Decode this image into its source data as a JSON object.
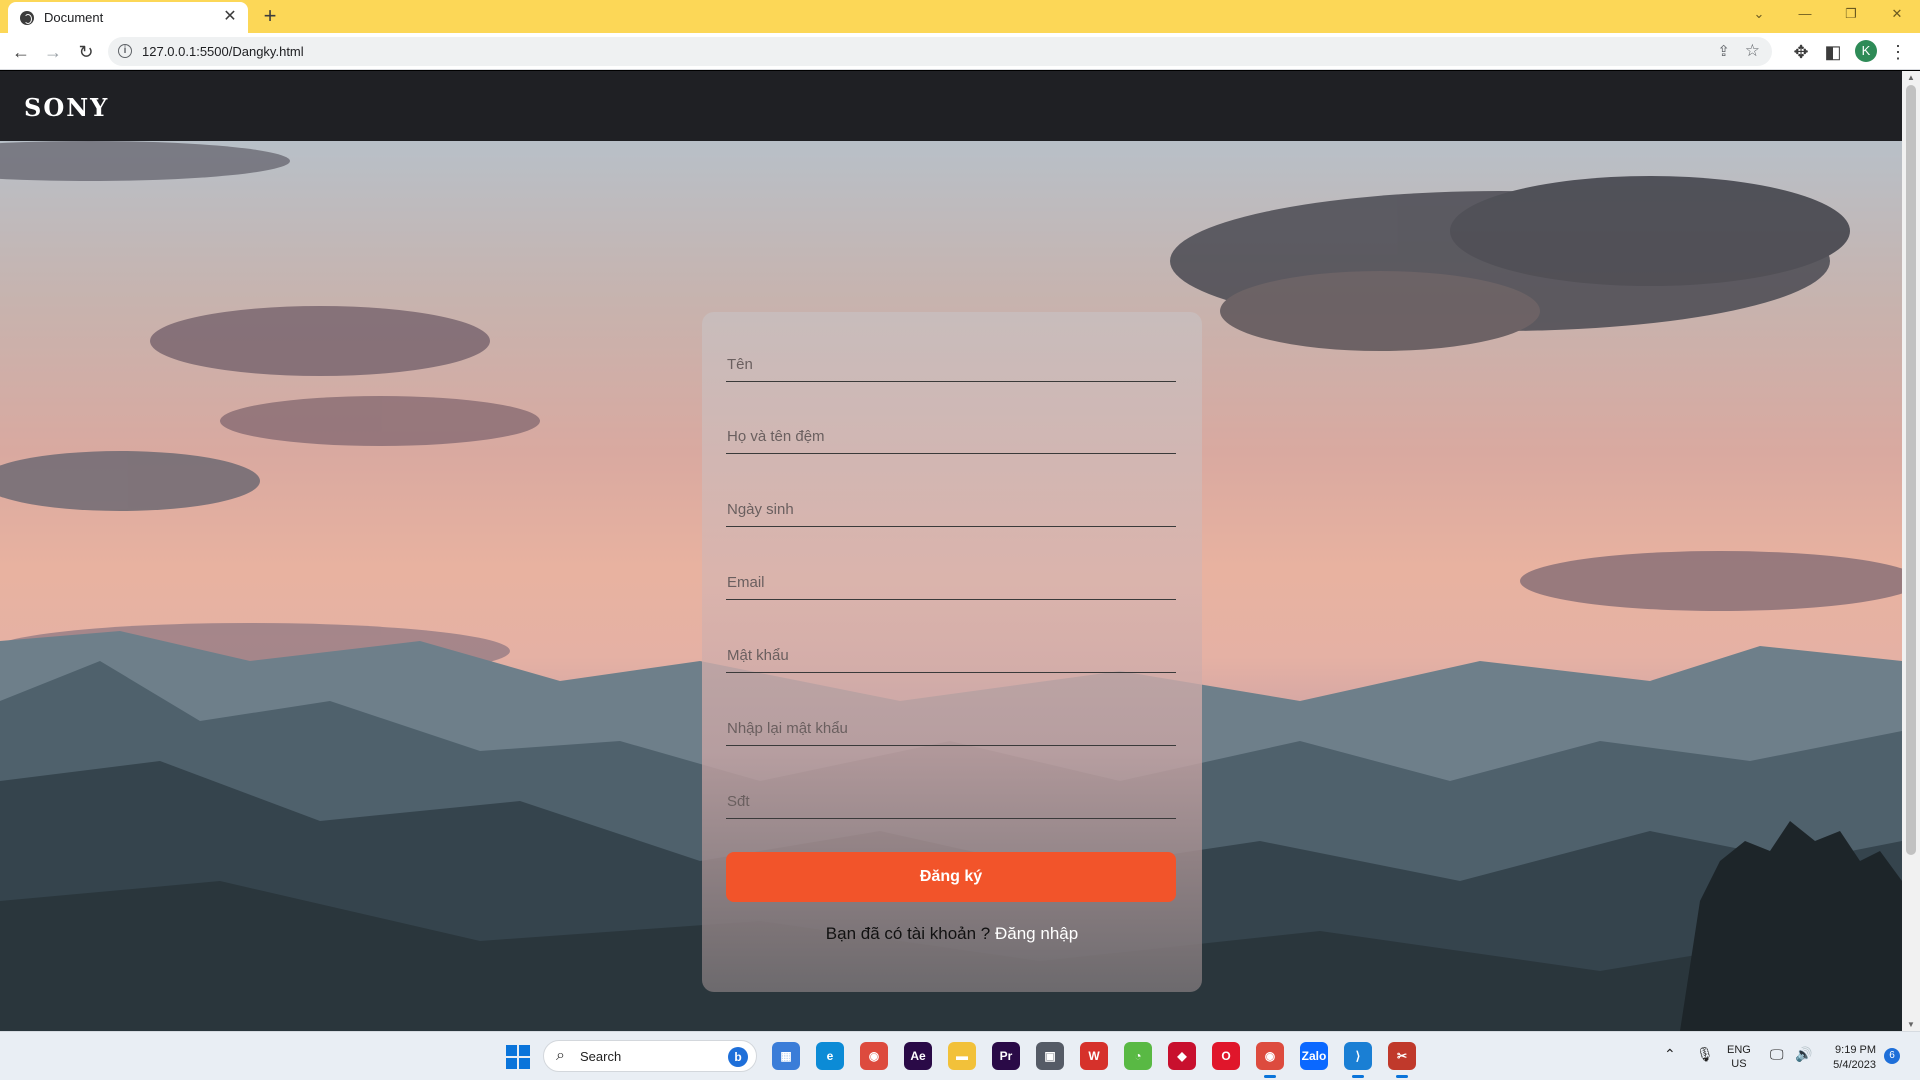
{
  "browser": {
    "tab_title": "Document",
    "tab_close": "✕",
    "new_tab": "+",
    "url": "127.0.0.1:5500/Dangky.html",
    "profile_initial": "K",
    "accent_color": "#fcd757"
  },
  "navbar": {
    "logo": "SONY"
  },
  "form": {
    "fields": [
      {
        "placeholder": "Tên"
      },
      {
        "placeholder": "Họ và tên đệm"
      },
      {
        "placeholder": "Ngày sinh"
      },
      {
        "placeholder": "Email"
      },
      {
        "placeholder": "Mật khẩu"
      },
      {
        "placeholder": "Nhập lại mật khẩu"
      },
      {
        "placeholder": "Sđt"
      }
    ],
    "submit_label": "Đăng ký",
    "have_account_text": "Bạn đã có tài khoản ?",
    "login_link": "Đăng nhập",
    "submit_color": "#f2542a"
  },
  "taskbar": {
    "search_label": "Search",
    "bing_letter": "b",
    "lang_line1": "ENG",
    "lang_line2": "US",
    "time": "9:19 PM",
    "date": "5/4/2023",
    "notification_count": "6",
    "apps": [
      {
        "name": "store",
        "label": "▦",
        "color": "#3b7dd8"
      },
      {
        "name": "edge",
        "label": "e",
        "color": "#0c8bd6"
      },
      {
        "name": "chrome",
        "label": "◉",
        "color": "#dd4b3e"
      },
      {
        "name": "after-effects",
        "label": "Ae",
        "color": "#2a0a47"
      },
      {
        "name": "file-explorer",
        "label": "▬",
        "color": "#f2c13a"
      },
      {
        "name": "premiere",
        "label": "Pr",
        "color": "#2a0a47"
      },
      {
        "name": "app-grid",
        "label": "▣",
        "color": "#555b66"
      },
      {
        "name": "wps",
        "label": "W",
        "color": "#d6312b"
      },
      {
        "name": "green-app",
        "label": "◔",
        "color": "#59b944"
      },
      {
        "name": "garena",
        "label": "◆",
        "color": "#c8102e"
      },
      {
        "name": "opera",
        "label": "O",
        "color": "#e0162b"
      },
      {
        "name": "chrome-profile",
        "label": "◉",
        "color": "#dd4b3e"
      },
      {
        "name": "zalo",
        "label": "Zalo",
        "color": "#0a68ff"
      },
      {
        "name": "vscode",
        "label": "⟩",
        "color": "#1a7fd4"
      },
      {
        "name": "snipping-tool",
        "label": "✂",
        "color": "#c0392b"
      }
    ]
  }
}
